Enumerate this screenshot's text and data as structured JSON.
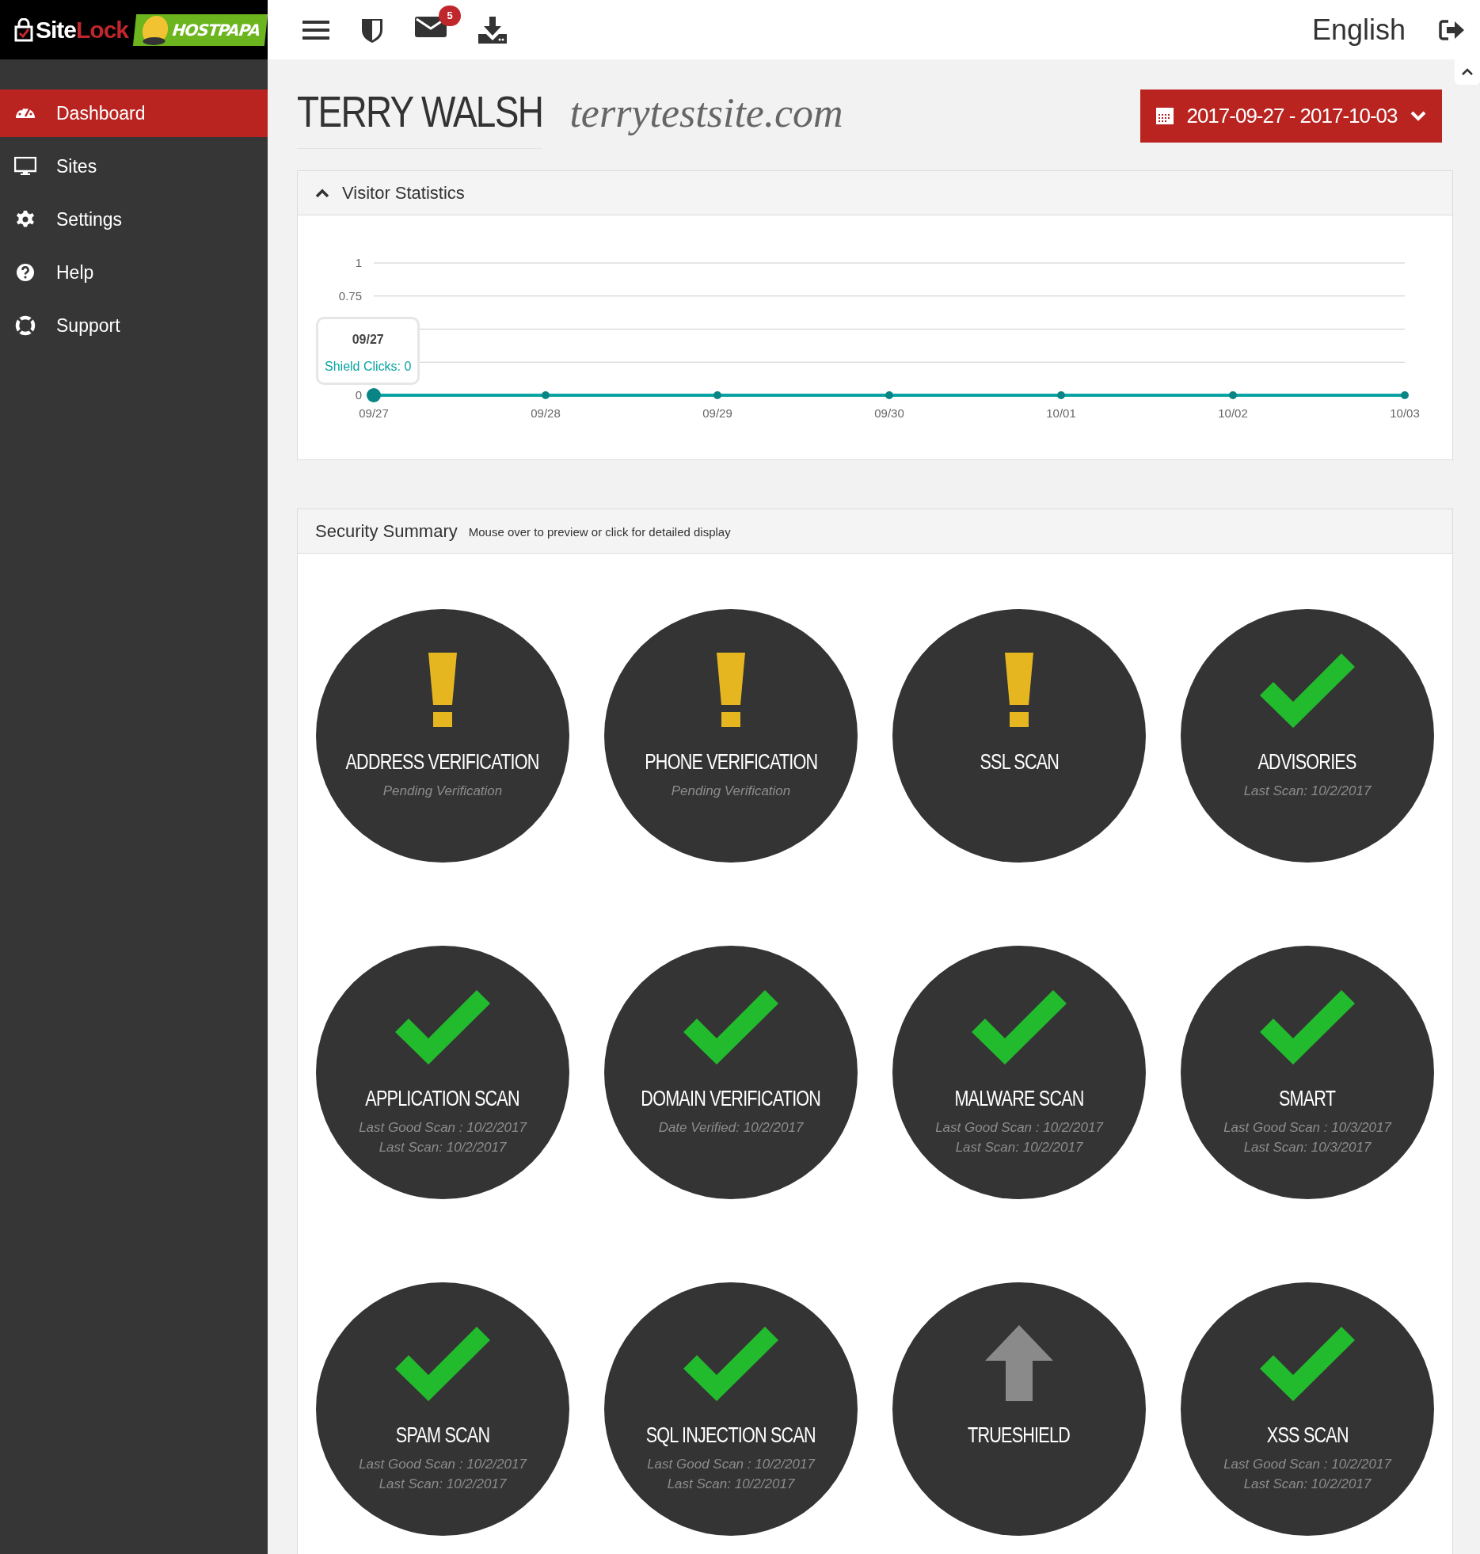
{
  "logo": {
    "first": "Site",
    "second": "Lock",
    "partner": "HOSTPAPA"
  },
  "sidebar": {
    "items": [
      {
        "label": "Dashboard",
        "selected": true
      },
      {
        "label": "Sites",
        "selected": false
      },
      {
        "label": "Settings",
        "selected": false
      },
      {
        "label": "Help",
        "selected": false
      },
      {
        "label": "Support",
        "selected": false
      }
    ]
  },
  "topbar": {
    "mail_count": "5",
    "language": "English"
  },
  "header": {
    "name": "TERRY WALSH",
    "site": "terrytestsite.com",
    "date_range": "2017-09-27 - 2017-10-03"
  },
  "visitor_statistics": {
    "title": "Visitor Statistics",
    "expanded": true,
    "tooltip": {
      "title": "09/27",
      "text": "Shield Clicks: 0"
    },
    "chart_data": {
      "type": "line",
      "categories": [
        "09/27",
        "09/28",
        "09/29",
        "09/30",
        "10/01",
        "10/02",
        "10/03"
      ],
      "series": [
        {
          "color": "#0aa3a3",
          "marker": true,
          "values": [
            0,
            0,
            0,
            0,
            0,
            0,
            0
          ]
        }
      ],
      "grid": true,
      "ylim": [
        0,
        1
      ],
      "yticks": [
        0,
        0.75,
        1
      ]
    }
  },
  "security_summary": {
    "title": "Security Summary",
    "hint": "Mouse over to preview or click for detailed display",
    "items": [
      {
        "title": "ADDRESS VERIFICATION",
        "kind": "warning",
        "lines": [
          "Pending Verification"
        ]
      },
      {
        "title": "PHONE VERIFICATION",
        "kind": "warning",
        "lines": [
          "Pending Verification"
        ]
      },
      {
        "title": "SSL SCAN",
        "kind": "warning"
      },
      {
        "title": "ADVISORIES",
        "kind": "ok",
        "lines": [
          "Last Scan: 10/2/2017"
        ]
      },
      {
        "title": "APPLICATION SCAN",
        "kind": "ok",
        "lines": [
          "Last Good Scan : 10/2/2017",
          "Last Scan: 10/2/2017"
        ]
      },
      {
        "title": "DOMAIN VERIFICATION",
        "kind": "ok",
        "lines": [
          "Date Verified: 10/2/2017"
        ]
      },
      {
        "title": "MALWARE SCAN",
        "kind": "ok",
        "lines": [
          "Last Good Scan : 10/2/2017",
          "Last Scan: 10/2/2017"
        ]
      },
      {
        "title": "SMART",
        "kind": "ok",
        "lines": [
          "Last Good Scan : 10/3/2017",
          "Last Scan: 10/3/2017"
        ]
      },
      {
        "title": "SPAM SCAN",
        "kind": "ok",
        "lines": [
          "Last Good Scan : 10/2/2017",
          "Last Scan: 10/2/2017"
        ]
      },
      {
        "title": "SQL INJECTION SCAN",
        "kind": "ok",
        "lines": [
          "Last Good Scan : 10/2/2017",
          "Last Scan: 10/2/2017"
        ]
      },
      {
        "title": "TRUESHIELD",
        "kind": "upgrade"
      },
      {
        "title": "XSS SCAN",
        "kind": "ok",
        "lines": [
          "Last Good Scan : 10/2/2017",
          "Last Scan: 10/2/2017"
        ]
      }
    ]
  }
}
